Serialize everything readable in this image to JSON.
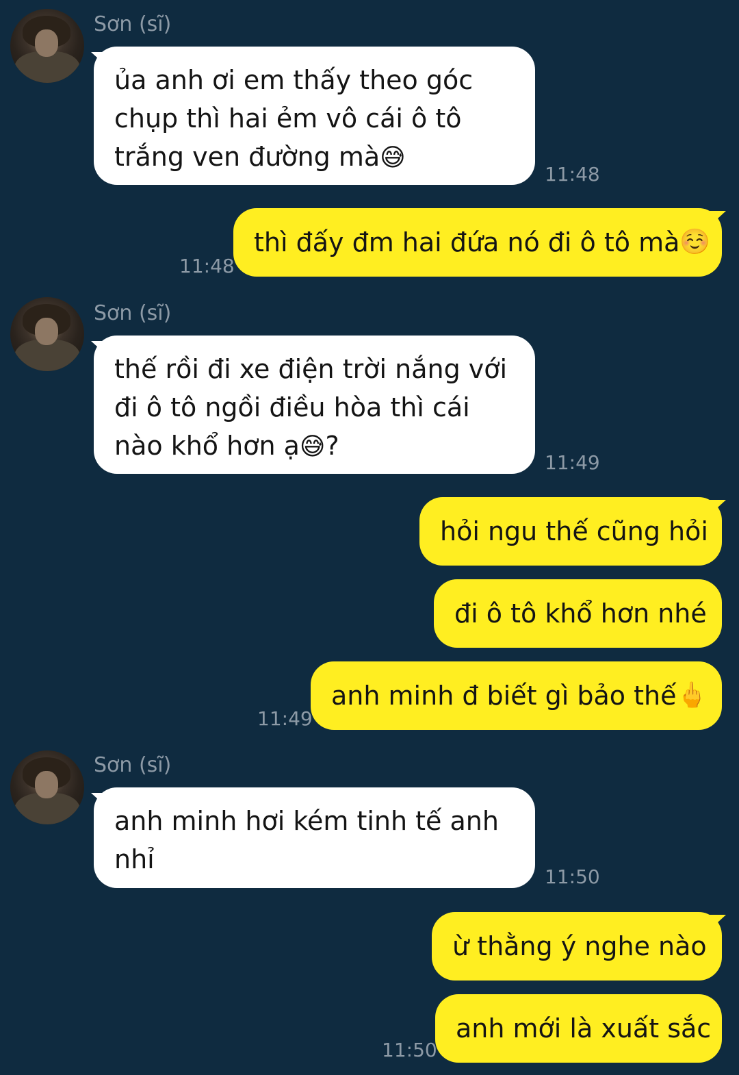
{
  "contact": {
    "name": "Sơn (sĩ)"
  },
  "colors": {
    "background": "#0f2b40",
    "incoming_bubble": "#ffffff",
    "outgoing_bubble": "#ffee21",
    "timestamp": "#8d9aa6"
  },
  "messages": [
    {
      "dir": "in",
      "text": "ủa anh ơi em thấy theo góc chụp thì hai ẻm vô cái ô tô trắng ven đường mà",
      "emoji": "😅",
      "after": "",
      "time": "11:48"
    },
    {
      "dir": "out",
      "text": "thì đấy đm hai đứa nó đi ô tô mà",
      "emoji": "☺️",
      "time": "11:48"
    },
    {
      "dir": "in",
      "text": "thế rồi đi xe điện trời nắng với đi ô tô ngồi điều hòa thì cái nào khổ hơn ạ",
      "emoji": "😅",
      "after": "?",
      "time": "11:49"
    },
    {
      "dir": "out",
      "text": "hỏi ngu thế cũng hỏi",
      "emoji": "",
      "time": ""
    },
    {
      "dir": "out",
      "text": "đi ô tô khổ hơn nhé",
      "emoji": "",
      "time": ""
    },
    {
      "dir": "out",
      "text": "anh minh đ biết gì bảo thế",
      "emoji": "🖕",
      "time": "11:49"
    },
    {
      "dir": "in",
      "text": "anh minh hơi kém tinh tế anh nhỉ",
      "emoji": "",
      "after": "",
      "time": "11:50"
    },
    {
      "dir": "out",
      "text": "ừ thằng ý nghe nào",
      "emoji": "",
      "time": ""
    },
    {
      "dir": "out",
      "text": "anh mới là xuất sắc",
      "emoji": "",
      "time": "11:50"
    }
  ]
}
